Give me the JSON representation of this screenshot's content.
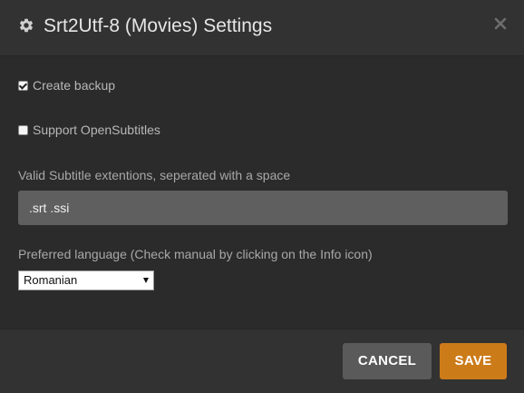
{
  "dialog": {
    "title": "Srt2Utf-8 (Movies) Settings",
    "icons": {
      "title": "gear-icon",
      "close": "close-icon"
    }
  },
  "options": {
    "create_backup": {
      "label": "Create backup",
      "checked": true
    },
    "support_opensubtitles": {
      "label": "Support OpenSubtitles",
      "checked": false
    }
  },
  "extensions": {
    "label": "Valid Subtitle extentions, seperated with a space",
    "value": ".srt .ssi"
  },
  "language": {
    "label": "Preferred language (Check manual by clicking on the Info icon)",
    "selected": "Romanian"
  },
  "footer": {
    "cancel_label": "CANCEL",
    "save_label": "SAVE"
  },
  "colors": {
    "background": "#2b2b2b",
    "header_footer": "#323232",
    "input_bg": "#5f5f5f",
    "cancel_bg": "#5a5a5a",
    "save_accent": "#cc7b19"
  }
}
